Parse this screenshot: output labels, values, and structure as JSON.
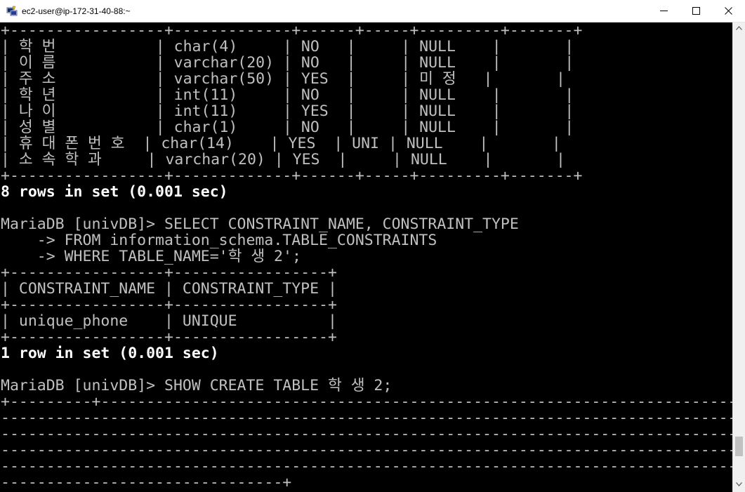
{
  "window": {
    "title": "ec2-user@ip-172-31-40-88:~"
  },
  "icons": {
    "app": "putty-terminal-icon",
    "minimize": "minimize-icon",
    "maximize": "maximize-icon",
    "close": "close-icon"
  },
  "colors": {
    "terminal_background": "#000000",
    "terminal_text": "#c0c0c0",
    "terminal_bold_text": "#ffffff"
  },
  "terminal": {
    "lines": [
      {
        "text": "+-----------------+-------------+------+-----+---------+-------+",
        "style": "normal"
      },
      {
        "text": "| 학 번           | char(4)     | NO   |     | NULL    |       |",
        "style": "normal"
      },
      {
        "text": "| 이 름           | varchar(20) | NO   |     | NULL    |       |",
        "style": "normal"
      },
      {
        "text": "| 주 소           | varchar(50) | YES  |     | 미 정   |       |",
        "style": "normal"
      },
      {
        "text": "| 학 년           | int(11)     | NO   |     | NULL    |       |",
        "style": "normal"
      },
      {
        "text": "| 나 이           | int(11)     | YES  |     | NULL    |       |",
        "style": "normal"
      },
      {
        "text": "| 성 별           | char(1)     | NO   |     | NULL    |       |",
        "style": "normal"
      },
      {
        "text": "| 휴 대 폰 번 호  | char(14)    | YES  | UNI | NULL    |       |",
        "style": "normal"
      },
      {
        "text": "| 소 속 학 과     | varchar(20) | YES  |     | NULL    |       |",
        "style": "normal"
      },
      {
        "text": "+-----------------+-------------+------+-----+---------+-------+",
        "style": "normal"
      },
      {
        "text": "8 rows in set (0.001 sec)",
        "style": "bright"
      },
      {
        "text": "",
        "style": "normal"
      },
      {
        "text": "MariaDB [univDB]> SELECT CONSTRAINT_NAME, CONSTRAINT_TYPE",
        "style": "normal"
      },
      {
        "text": "    -> FROM information_schema.TABLE_CONSTRAINTS",
        "style": "normal"
      },
      {
        "text": "    -> WHERE TABLE_NAME='학 생 2';",
        "style": "normal"
      },
      {
        "text": "+-----------------+-----------------+",
        "style": "normal"
      },
      {
        "text": "| CONSTRAINT_NAME | CONSTRAINT_TYPE |",
        "style": "normal"
      },
      {
        "text": "+-----------------+-----------------+",
        "style": "normal"
      },
      {
        "text": "| unique_phone    | UNIQUE          |",
        "style": "normal"
      },
      {
        "text": "+-----------------+-----------------+",
        "style": "normal"
      },
      {
        "text": "1 row in set (0.001 sec)",
        "style": "bright"
      },
      {
        "text": "",
        "style": "normal"
      },
      {
        "text": "MariaDB [univDB]> SHOW CREATE TABLE 학 생 2;",
        "style": "normal"
      },
      {
        "text": "+---------+-------------------------------------------------------------------------------------------",
        "style": "normal"
      },
      {
        "text": "----------------------------------------------------------------------------------------------------",
        "style": "normal"
      },
      {
        "text": "----------------------------------------------------------------------------------------------------",
        "style": "normal"
      },
      {
        "text": "----------------------------------------------------------------------------------------------------",
        "style": "normal"
      },
      {
        "text": "----------------------------------------------------------------------------------------------------",
        "style": "normal"
      },
      {
        "text": "-------------------------------+",
        "style": "normal"
      }
    ]
  }
}
